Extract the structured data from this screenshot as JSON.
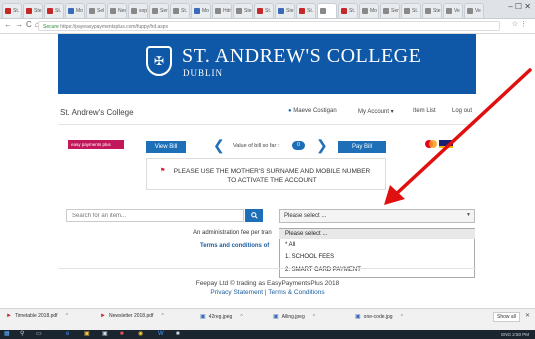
{
  "browser": {
    "tabs": [
      "St.",
      "Ste.",
      "St.",
      "Mo",
      "Sel",
      "Nes",
      "sop",
      "Ser",
      "St.",
      "Mo",
      "Hdr",
      "Ste",
      "St.",
      "Ste",
      "St.",
      "",
      "St.",
      "Mo",
      "Ser",
      "St.",
      "Ste",
      "Ve",
      "Ve"
    ],
    "url_secure": "Secure",
    "url": "https://payeasypaymentsplus.com/fuppy/hd.aspx",
    "window_controls": "–   ☐   ✕"
  },
  "colors": {
    "brand_blue": "#0f58a8",
    "button_blue": "#1d6fb8",
    "annotation_red": "#e01010",
    "notice_red": "#d0103a"
  },
  "banner": {
    "title": "ST. ANDREW'S COLLEGE",
    "subtitle": "DUBLIN"
  },
  "nav": {
    "site_name": "St. Andrew's College",
    "user_name": "Maeve Costigan",
    "my_account": "My Account ▾",
    "item_list": "Item List",
    "log_out": "Log out"
  },
  "bill": {
    "logo_text": "easy payments plus",
    "view_bill": "View Bill",
    "value_label": "Value of bill so far :",
    "value_count": "0",
    "pay_bill": "Pay Bill"
  },
  "notice": {
    "text": "PLEASE USE THE MOTHER'S SURNAME AND MOBILE NUMBER TO ACTIVATE THE ACCOUNT"
  },
  "search": {
    "placeholder": "Search for an item...",
    "button_icon": "search-icon"
  },
  "select": {
    "value": "Please select ...",
    "options": [
      "Please select ...",
      "* All",
      "1. SCHOOL FEES",
      "2. SMART CARD PAYMENT"
    ]
  },
  "fees": {
    "admin_fee": "An administration fee per tran",
    "terms": "Terms and conditions of"
  },
  "footer": {
    "line1": "Feepay Ltd © trading as EasyPaymentsPlus 2018",
    "line2": "Privacy Statement | Terms & Conditions"
  },
  "downloads": {
    "items": [
      "Timetable 2018.pdf",
      "Newsletter 2018.pdf",
      "42reg.jpeg",
      "Alling.jpeg",
      "one-code.jpg"
    ],
    "show_all": "Show all"
  },
  "taskbar": {
    "tray_time": "2:50 PM",
    "tray_lang": "ENG"
  }
}
